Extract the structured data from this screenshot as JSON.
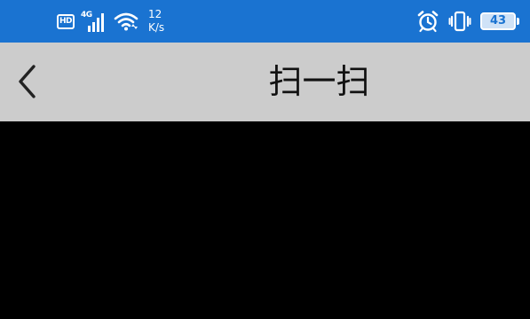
{
  "status_bar": {
    "hd_label": "HD",
    "network_type": "4G",
    "speed_value": "12",
    "speed_unit": "K/s",
    "battery_level": "43",
    "icons": [
      "hd-icon",
      "signal-icon",
      "wifi-icon",
      "alarm-icon",
      "vibrate-icon",
      "battery-icon"
    ],
    "background_color": "#1a73d1"
  },
  "header": {
    "title": "扫一扫",
    "back_icon": "chevron-left-icon",
    "background_color": "#cccccc"
  },
  "camera_view": {
    "background_color": "#000000"
  }
}
